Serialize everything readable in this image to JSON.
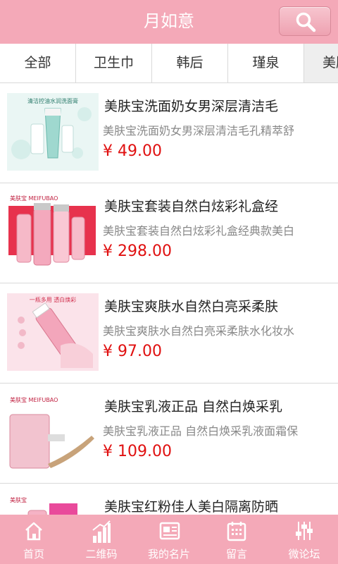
{
  "header": {
    "title": "月如意",
    "search_icon": "search-icon"
  },
  "tabs": [
    {
      "label": "全部"
    },
    {
      "label": "卫生巾"
    },
    {
      "label": "韩后"
    },
    {
      "label": "瑾泉"
    },
    {
      "label": "美肤宝"
    }
  ],
  "products": [
    {
      "title": "美肤宝洗面奶女男深层清洁毛",
      "desc": "美肤宝洗面奶女男深层清洁毛孔精萃舒",
      "price": "¥ 49.00",
      "image_text": "清洁控油水润洗面膏"
    },
    {
      "title": "美肤宝套装自然白炫彩礼盒经",
      "desc": "美肤宝套装自然白炫彩礼盒经典款美白",
      "price": "¥ 298.00",
      "image_text": "美肤宝 MEIFUBAO"
    },
    {
      "title": "美肤宝爽肤水自然白亮采柔肤",
      "desc": "美肤宝爽肤水自然白亮采柔肤水化妆水",
      "price": "¥ 97.00",
      "image_text": "一瓶多用 透白焕彩"
    },
    {
      "title": "美肤宝乳液正品 自然白焕采乳",
      "desc": "美肤宝乳液正品 自然白焕采乳液面霜保",
      "price": "¥ 109.00",
      "image_text": "美肤宝 MEIFUBAO"
    },
    {
      "title": "美肤宝红粉佳人美白隔离防晒",
      "desc": "",
      "price": "",
      "image_text": "美肤宝"
    }
  ],
  "tabbar": [
    {
      "label": "首页",
      "icon": "home-icon"
    },
    {
      "label": "二维码",
      "icon": "bar-chart-icon"
    },
    {
      "label": "我的名片",
      "icon": "card-icon"
    },
    {
      "label": "留言",
      "icon": "calendar-icon"
    },
    {
      "label": "微论坛",
      "icon": "sliders-icon"
    }
  ],
  "colors": {
    "accent": "#f4a9b8",
    "price": "#e01010",
    "active_tab": "#eeeeee"
  }
}
